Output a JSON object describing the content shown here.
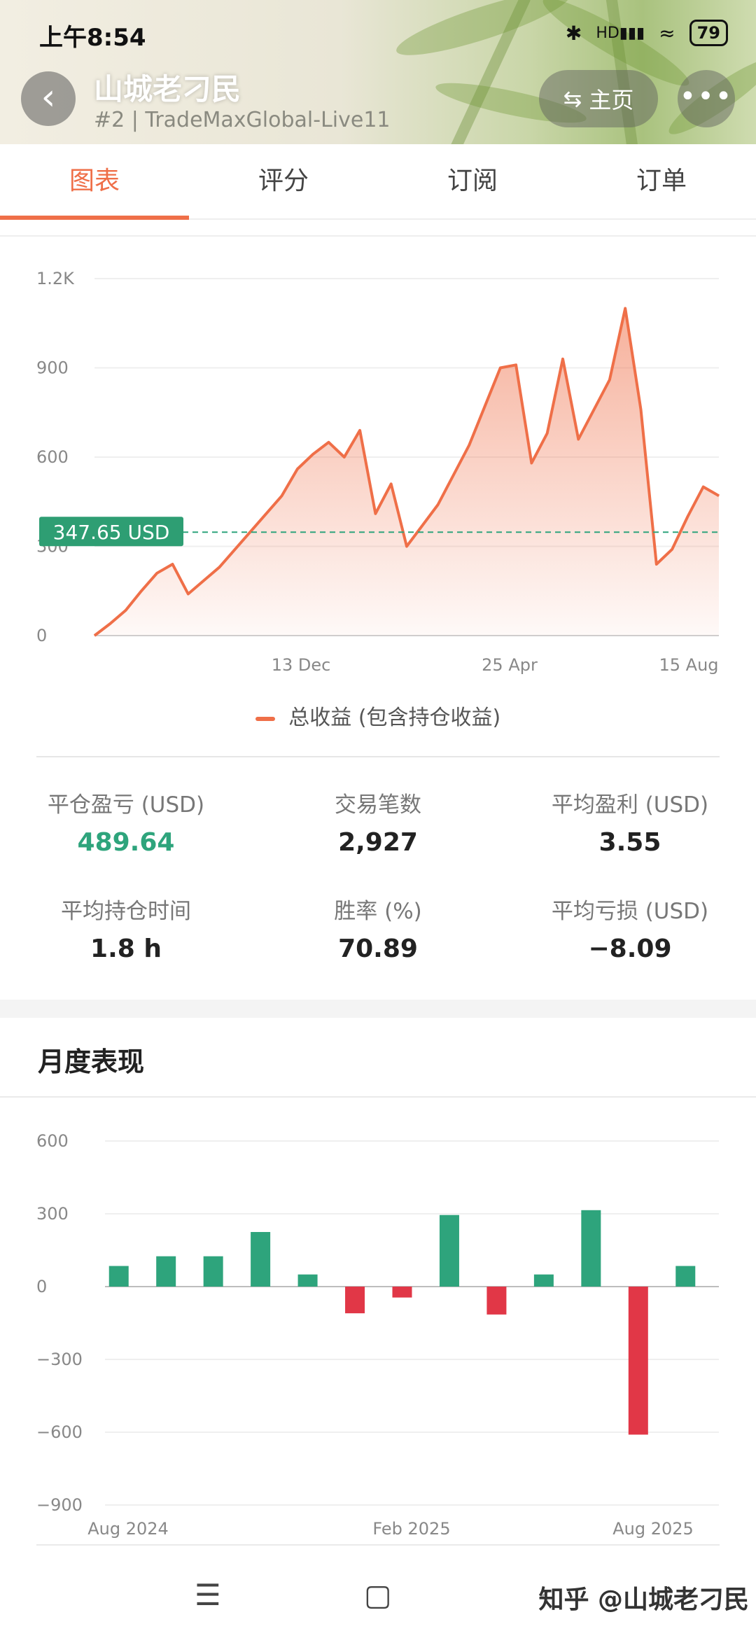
{
  "status_bar": {
    "time": "上午8:54",
    "battery": "79",
    "network_label": "HD"
  },
  "header": {
    "title": "山城老刁民",
    "subtitle": "#2 | TradeMaxGlobal-Live11",
    "home_label": "主页",
    "back_icon": "chevron-left-icon",
    "more_icon": "more-horizontal-icon"
  },
  "tabs": [
    {
      "label": "图表",
      "active": true
    },
    {
      "label": "评分",
      "active": false
    },
    {
      "label": "订阅",
      "active": false
    },
    {
      "label": "订单",
      "active": false
    }
  ],
  "chart_data": [
    {
      "type": "area",
      "y_ticks": [
        "0",
        "300",
        "600",
        "900",
        "1.2K"
      ],
      "x_ticks": [
        "13 Dec",
        "25 Apr",
        "15 Aug"
      ],
      "ylim": [
        0,
        1200
      ],
      "current_value_label": "347.65 USD",
      "current_value": 347.65,
      "legend": "总收益 (包含持仓收益)",
      "color": "#ef6f48",
      "points": [
        0,
        40,
        85,
        150,
        210,
        240,
        140,
        185,
        230,
        290,
        350,
        410,
        470,
        560,
        610,
        650,
        600,
        690,
        410,
        510,
        300,
        370,
        440,
        540,
        640,
        770,
        900,
        910,
        580,
        680,
        930,
        660,
        760,
        860,
        1100,
        760,
        240,
        290,
        400,
        500,
        470
      ]
    },
    {
      "type": "bar",
      "y_ticks": [
        "600",
        "300",
        "0",
        "−300",
        "−600",
        "−900"
      ],
      "x_ticks": [
        "Aug 2024",
        "Feb 2025",
        "Aug 2025"
      ],
      "ylim": [
        -900,
        600
      ],
      "values": [
        85,
        125,
        125,
        225,
        50,
        -110,
        -45,
        295,
        -115,
        50,
        315,
        -610,
        85
      ],
      "positive_color": "#2ea47c",
      "negative_color": "#e13747"
    }
  ],
  "stats": [
    {
      "label": "平仓盈亏 (USD)",
      "value": "489.64",
      "green": true
    },
    {
      "label": "交易笔数",
      "value": "2,927",
      "green": false
    },
    {
      "label": "平均盈利 (USD)",
      "value": "3.55",
      "green": false
    },
    {
      "label": "平均持仓时间",
      "value": "1.8 h",
      "green": false
    },
    {
      "label": "胜率 (%)",
      "value": "70.89",
      "green": false
    },
    {
      "label": "平均亏损 (USD)",
      "value": "−8.09",
      "green": false
    }
  ],
  "monthly": {
    "title": "月度表现"
  },
  "watermark": "知乎 @山城老刁民",
  "nav": {
    "menu_icon": "menu-icon",
    "home_icon": "square-home-icon",
    "back_icon": "back-triangle-icon"
  }
}
